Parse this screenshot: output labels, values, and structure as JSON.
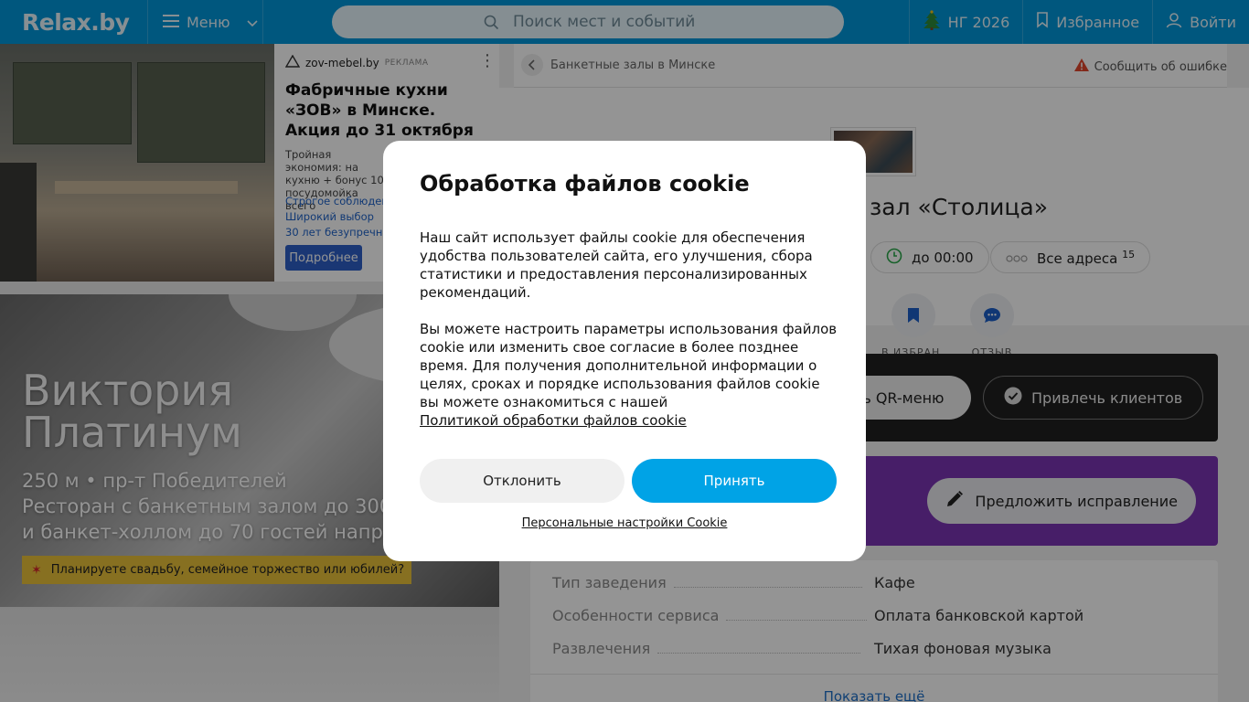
{
  "header": {
    "logo": "Relax.by",
    "menu_label": "Меню",
    "search_placeholder": "Поиск мест и событий",
    "ny_label": "НГ 2026",
    "favorites_label": "Избранное",
    "login_label": "Войти",
    "icons": [
      "menu-icon",
      "chevron-down-icon",
      "search-icon",
      "tree-icon",
      "bookmark-icon",
      "user-icon"
    ]
  },
  "ad": {
    "brand": "zov-mebel.by",
    "tag": "РЕКЛАМА",
    "title": "Фабричные кухни «ЗОВ» в Минске. Акция до 31 октября",
    "text": "Тройная экономия: на кухню + бонус 10 посудомойка всего",
    "links": [
      "Строгое соблюдени",
      "Широкий выбор",
      "30 лет безупречной"
    ],
    "button": "Подробнее"
  },
  "promo": {
    "title_line1": "Виктория",
    "title_line2": "Платинум",
    "sub_line1": "250 м • пр-т Победителей",
    "sub_line2": "Ресторан с банкетным залом до 300",
    "sub_line3": "и банкет-холлом до 70 гостей напр",
    "badge": "Планируете свадьбу, семейное торжество или юбилей?"
  },
  "breadcrumb": {
    "text": "Банкетные залы в Минске",
    "report": "Сообщить об ошибке"
  },
  "venue": {
    "title_visible": "зал «Столица»",
    "hours": "до 00:00",
    "addresses_label": "Все адреса",
    "addresses_count": "15",
    "action_favorite": "В ИЗБРАН...",
    "action_review": "ОТЗЫВ"
  },
  "cards": {
    "qr_menu": "ть QR-меню",
    "attract_clients": "Привлечь клиентов",
    "suggest_fix": "Предложить исправление"
  },
  "props": {
    "rows": [
      {
        "key": "Тип заведения",
        "value": "Кафе"
      },
      {
        "key": "Особенности сервиса",
        "value": "Оплата банковской картой"
      },
      {
        "key": "Развлечения",
        "value": "Тихая фоновая музыка"
      }
    ],
    "show_more": "Показать ещё"
  },
  "cookie_modal": {
    "title": "Обработка файлов cookie",
    "paragraph1": "Наш сайт использует файлы cookie для обеспечения удобства пользователей сайта, его улучшения, сбора статистики и предоставления персонализированных рекомендаций.",
    "paragraph2": "Вы можете настроить параметры использования файлов cookie или изменить свое согласие в более позднее время. Для получения дополнительной информации о целях, сроках и порядке использования файлов cookie вы можете ознакомиться с нашей",
    "policy_link": "Политикой обработки файлов cookie",
    "decline": "Отклонить",
    "accept": "Принять",
    "settings": "Персональные настройки Cookie"
  },
  "colors": {
    "brand_blue": "#0096d9",
    "accept_blue": "#00a3e6",
    "purple_card": "#7b35b4",
    "badge_yellow": "#e9c13a"
  }
}
